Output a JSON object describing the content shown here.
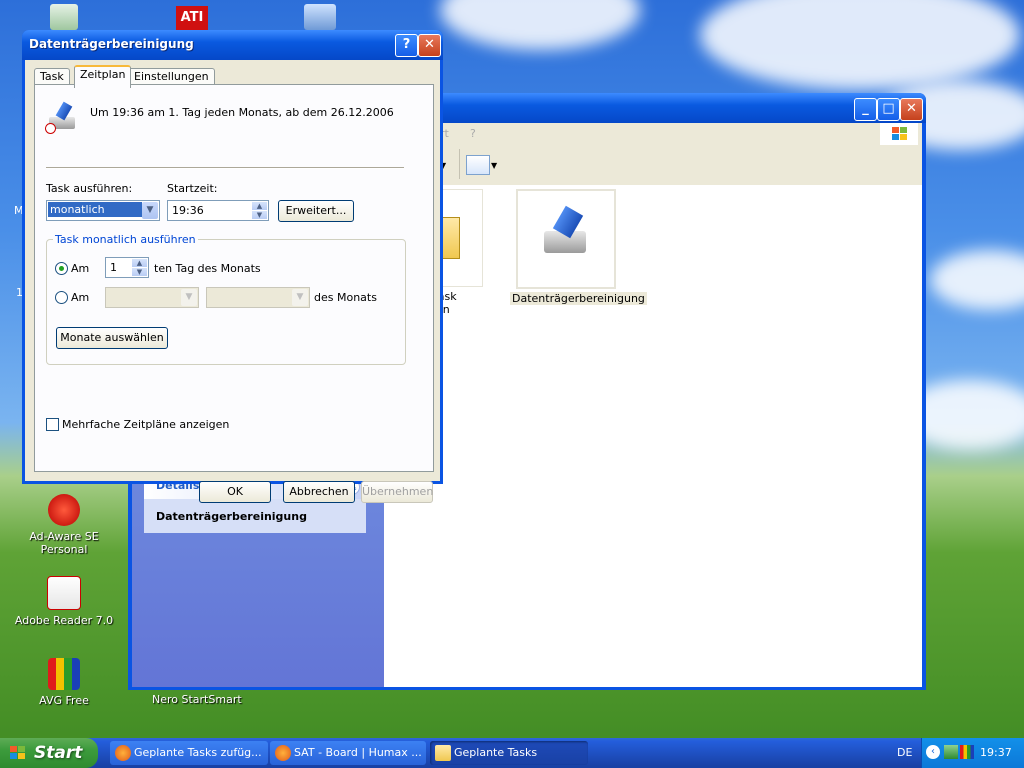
{
  "desktop": {
    "icons": [
      {
        "label": "Ad-Aware SE Personal"
      },
      {
        "label": "Adobe Reader 7.0"
      },
      {
        "label": "AVG Free"
      },
      {
        "label": "Nero StartSmart"
      }
    ],
    "partial_labels": {
      "m": "M",
      "one": "1"
    }
  },
  "explorer": {
    "menu_fragment_1": "rt",
    "menu_fragment_2": "?",
    "details_header": "Details",
    "details_item": "Datenträgerbereinigung",
    "items": [
      {
        "label_line1": "ren Task",
        "label_line2": "fügen"
      },
      {
        "label_line1": "Datenträgerbereinigung",
        "label_line2": ""
      }
    ]
  },
  "dialog": {
    "title": "Datenträgerbereinigung",
    "help_btn": "?",
    "close_btn": "✕",
    "tabs": [
      {
        "label": "Task",
        "active": false
      },
      {
        "label": "Zeitplan",
        "active": true
      },
      {
        "label": "Einstellungen",
        "active": false
      }
    ],
    "schedule_summary": "Um 19:36 am 1. Tag jeden Monats, ab dem 26.12.2006",
    "run_task_label": "Task ausführen:",
    "run_task_value": "monatlich",
    "start_time_label": "Startzeit:",
    "start_time_value": "19:36",
    "advanced_btn": "Erweitert...",
    "group_label": "Task monatlich ausführen",
    "radio_am_1": "Am",
    "day_value": "1",
    "day_suffix": "ten Tag des Monats",
    "radio_am_2": "Am",
    "month_suffix": "des Monats",
    "choose_months_btn": "Monate auswählen",
    "multi_schedule_label": "Mehrfache Zeitpläne anzeigen",
    "ok_btn": "OK",
    "cancel_btn": "Abbrechen",
    "apply_btn": "Übernehmen"
  },
  "taskbar": {
    "start_label": "Start",
    "buttons": [
      {
        "label": "Geplante Tasks zufüg...",
        "active": false
      },
      {
        "label": "SAT - Board | Humax ...",
        "active": false
      },
      {
        "label": "Geplante Tasks",
        "active": true
      }
    ],
    "lang": "DE",
    "time": "19:37"
  },
  "colors": {
    "xp_blue": "#0a54e3",
    "dialog_face": "#ece9d8",
    "start_green": "#3c9b3c",
    "selection_blue": "#316ac5"
  }
}
